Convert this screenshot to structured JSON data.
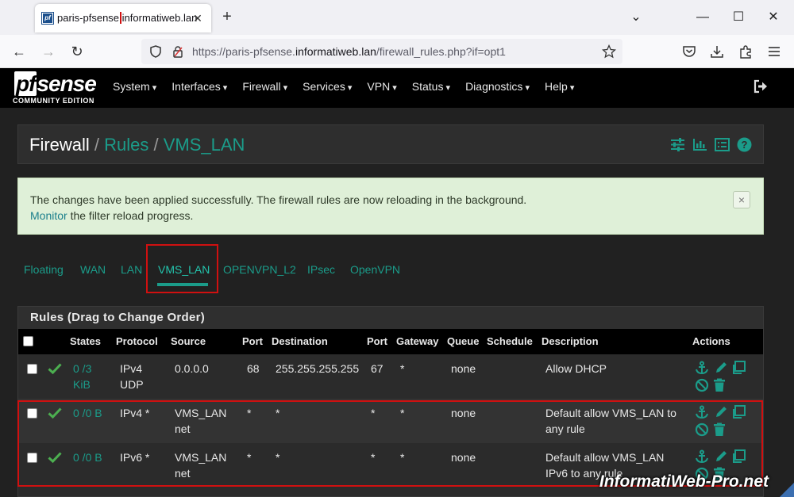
{
  "browser": {
    "tab_title_highlight": "paris-pfsense",
    "tab_title_rest": ".informatiweb.lan",
    "favicon_text": "pf",
    "url_prefix": "https://paris-pfsense.",
    "url_domain": "informatiweb.lan",
    "url_path": "/firewall_rules.php?if=opt1"
  },
  "logo": {
    "word_pf": "pf",
    "word_sense": "sense",
    "edition": "COMMUNITY EDITION"
  },
  "menu": [
    "System",
    "Interfaces",
    "Firewall",
    "Services",
    "VPN",
    "Status",
    "Diagnostics",
    "Help"
  ],
  "breadcrumb": {
    "c1": "Firewall",
    "sep": " / ",
    "c2": "Rules",
    "c3": "VMS_LAN"
  },
  "alert": {
    "line1": "The changes have been applied successfully. The firewall rules are now reloading in the background.",
    "link": "Monitor",
    "line2_rest": " the filter reload progress.",
    "close": "×"
  },
  "tabs": [
    {
      "label": "Floating"
    },
    {
      "label": "WAN"
    },
    {
      "label": "LAN"
    },
    {
      "label": "VMS_LAN",
      "active": true
    },
    {
      "label": "OPENVPN_L2"
    },
    {
      "label": "IPsec"
    },
    {
      "label": "OpenVPN"
    }
  ],
  "panel_title": "Rules (Drag to Change Order)",
  "columns": [
    "States",
    "Protocol",
    "Source",
    "Port",
    "Destination",
    "Port",
    "Gateway",
    "Queue",
    "Schedule",
    "Description",
    "Actions"
  ],
  "rules": [
    {
      "states1": "0 /3",
      "states2": "KiB",
      "proto1": "IPv4",
      "proto2": "UDP",
      "source1": "0.0.0.0",
      "source2": "",
      "sport": "68",
      "dest": "255.255.255.255",
      "dport": "67",
      "gateway": "*",
      "queue": "none",
      "schedule": "",
      "desc1": "Allow DHCP",
      "desc2": ""
    },
    {
      "states1": "0 /0 B",
      "states2": "",
      "proto1": "IPv4 *",
      "proto2": "",
      "source1": "VMS_LAN",
      "source2": "net",
      "sport": "*",
      "dest": "*",
      "dport": "*",
      "gateway": "*",
      "queue": "none",
      "schedule": "",
      "desc1": "Default allow VMS_LAN to",
      "desc2": "any rule"
    },
    {
      "states1": "0 /0 B",
      "states2": "",
      "proto1": "IPv6 *",
      "proto2": "",
      "source1": "VMS_LAN",
      "source2": "net",
      "sport": "*",
      "dest": "*",
      "dport": "*",
      "gateway": "*",
      "queue": "none",
      "schedule": "",
      "desc1": "Default allow VMS_LAN",
      "desc2": "IPv6 to any rule"
    }
  ],
  "watermark": "InformatiWeb-Pro.net",
  "colors": {
    "accent": "#1b9c8a",
    "alert_bg": "#dff0d8",
    "highlight": "#d01010",
    "check": "#4caf50"
  }
}
